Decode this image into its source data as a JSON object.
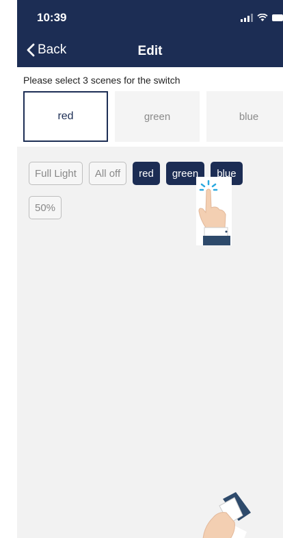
{
  "status_bar": {
    "time": "10:39"
  },
  "nav": {
    "back_label": "Back",
    "title": "Edit"
  },
  "instruction": "Please select 3 scenes for the switch",
  "slots": [
    {
      "label": "red",
      "selected": true
    },
    {
      "label": "green",
      "selected": false
    },
    {
      "label": "blue",
      "selected": false
    }
  ],
  "scenes": [
    {
      "label": "Full Light",
      "style": "outline"
    },
    {
      "label": "All off",
      "style": "outline"
    },
    {
      "label": "red",
      "style": "filled"
    },
    {
      "label": "green",
      "style": "filled"
    },
    {
      "label": "blue",
      "style": "filled"
    },
    {
      "label": "50%",
      "style": "outline"
    }
  ],
  "icons": [
    "signal-icon",
    "wifi-icon",
    "battery-icon",
    "chevron-left-icon",
    "tap-hand-icon",
    "hand-icon"
  ],
  "colors": {
    "nav_bg": "#1c2d54",
    "chip_filled": "#1c2d54",
    "page_bg": "#f2f2f2"
  }
}
